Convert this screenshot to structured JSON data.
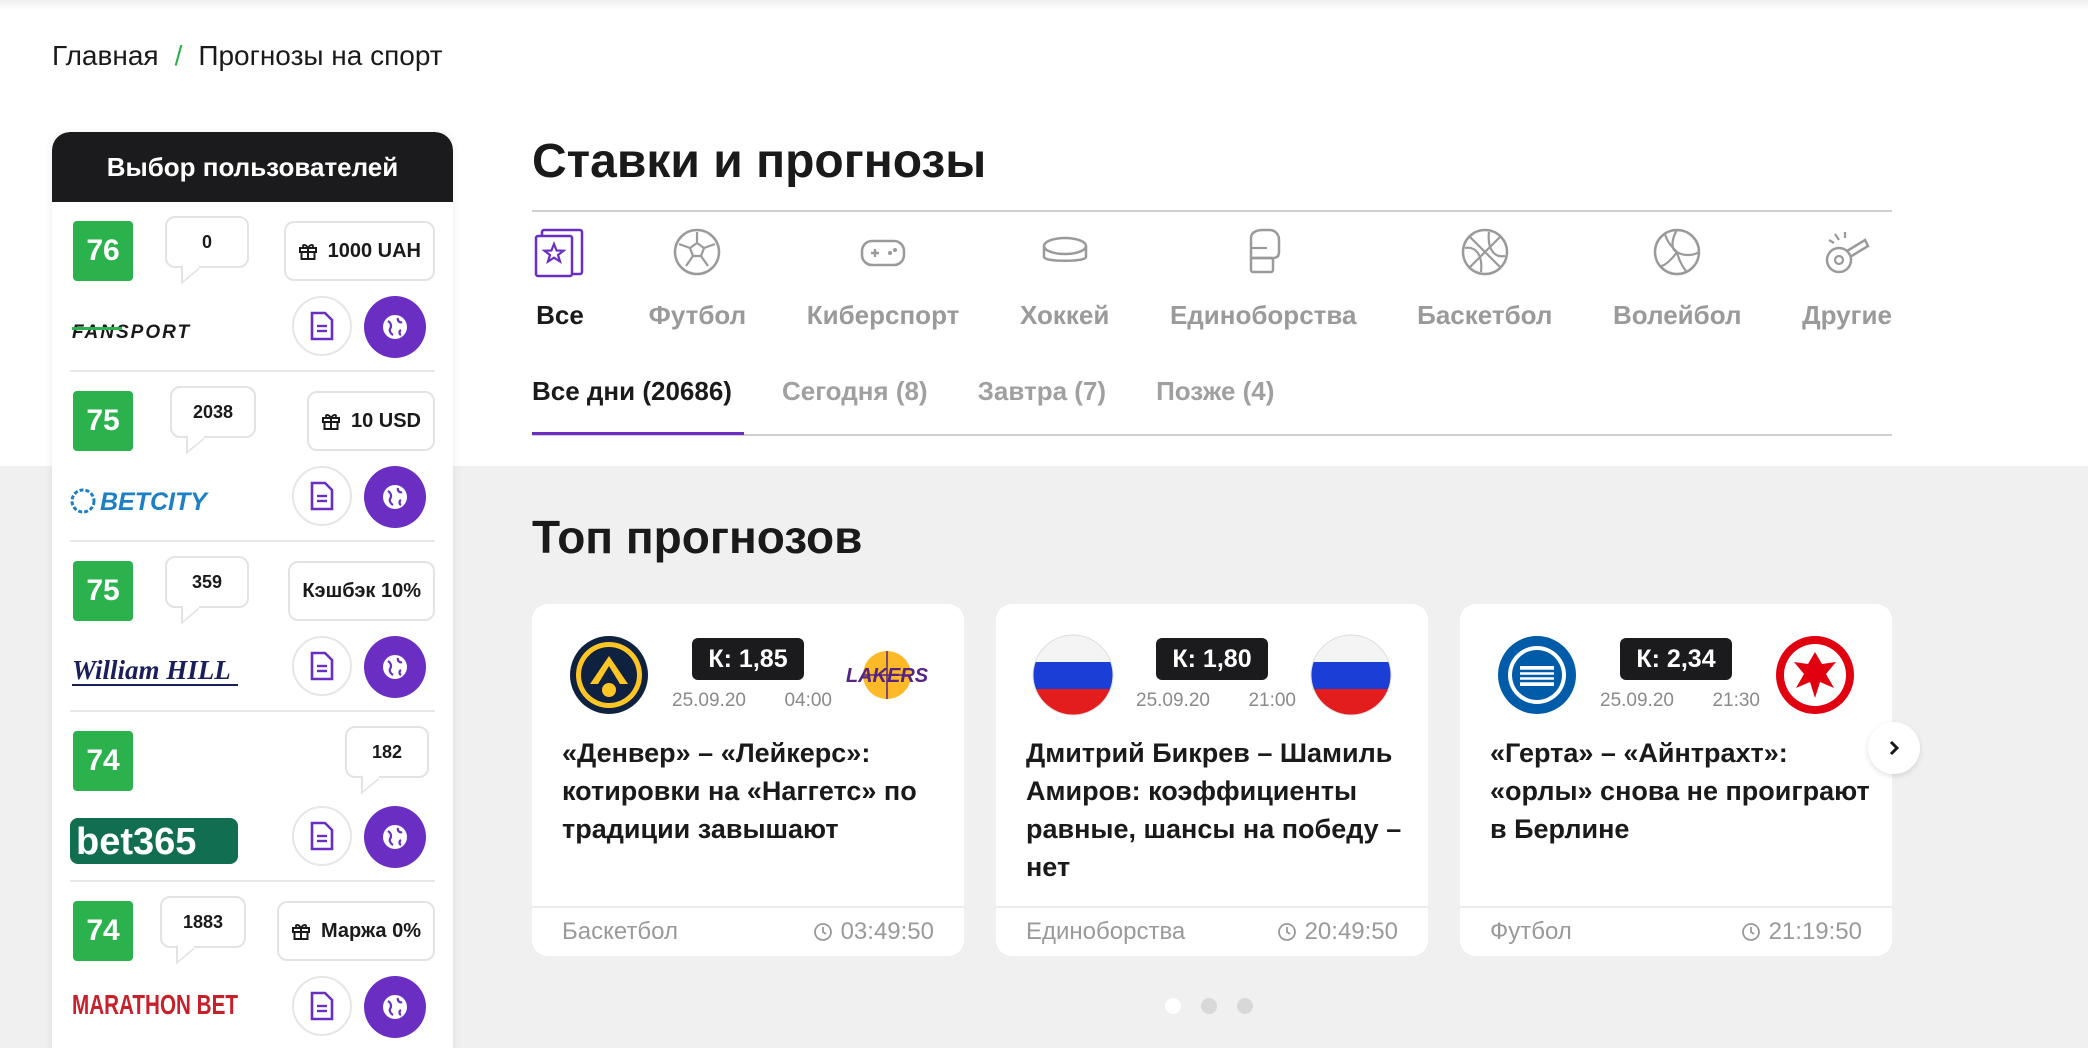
{
  "breadcrumb": {
    "home": "Главная",
    "separator": "/",
    "current": "Прогнозы на спорт"
  },
  "sidebar": {
    "title": "Выбор пользователей",
    "items": [
      {
        "rating": "76",
        "reviews": "0",
        "bonus": "1000 UAH",
        "bonus_icon": "gift-icon",
        "brand": "FANSPORT"
      },
      {
        "rating": "75",
        "reviews": "2038",
        "bonus": "10 USD",
        "bonus_icon": "gift-icon",
        "brand": "BETCITY"
      },
      {
        "rating": "75",
        "reviews": "359",
        "bonus": "Кэшбэк 10%",
        "bonus_icon": "",
        "brand": "William HILL"
      },
      {
        "rating": "74",
        "reviews": "182",
        "bonus": "",
        "bonus_icon": "",
        "brand": "bet365"
      },
      {
        "rating": "74",
        "reviews": "1883",
        "bonus": "Маржа 0%",
        "bonus_icon": "gift-icon",
        "brand": "MARATHON BET"
      }
    ]
  },
  "main": {
    "title": "Ставки и прогнозы",
    "sport_tabs": [
      {
        "label": "Все",
        "icon": "all-sports-icon",
        "active": true
      },
      {
        "label": "Футбол",
        "icon": "football-icon"
      },
      {
        "label": "Киберспорт",
        "icon": "gamepad-icon"
      },
      {
        "label": "Хоккей",
        "icon": "hockey-puck-icon"
      },
      {
        "label": "Единоборства",
        "icon": "boxing-glove-icon"
      },
      {
        "label": "Баскетбол",
        "icon": "basketball-icon"
      },
      {
        "label": "Волейбол",
        "icon": "volleyball-icon"
      },
      {
        "label": "Другие",
        "icon": "whistle-icon"
      }
    ],
    "day_tabs": [
      {
        "label": "Все дни (20686)",
        "active": true
      },
      {
        "label": "Сегодня (8)"
      },
      {
        "label": "Завтра (7)"
      },
      {
        "label": "Позже (4)"
      }
    ],
    "top_title": "Топ прогнозов",
    "cards": [
      {
        "coef": "К: 1,85",
        "date": "25.09.20",
        "time": "04:00",
        "title": "«Денвер» – «Лейкерс»: котировки на «Наггетс» по традиции завышают",
        "sport": "Баскетбол",
        "countdown": "03:49:50",
        "team_left": "denver-nuggets-logo",
        "team_right": "lakers-logo"
      },
      {
        "coef": "К: 1,80",
        "date": "25.09.20",
        "time": "21:00",
        "title": "Дмитрий Бикрев – Шамиль Амиров: коэффициенты равные, шансы на победу – нет",
        "sport": "Единоборства",
        "countdown": "20:49:50",
        "team_left": "russia-flag",
        "team_right": "russia-flag"
      },
      {
        "coef": "К: 2,34",
        "date": "25.09.20",
        "time": "21:30",
        "title": "«Герта» – «Айнтрахт»: «орлы» снова не проиграют в Берлине",
        "sport": "Футбол",
        "countdown": "21:19:50",
        "team_left": "hertha-logo",
        "team_right": "eintracht-logo"
      }
    ],
    "slider_pages": 3,
    "slider_active": 1
  },
  "colors": {
    "accent": "#6a2fc2",
    "rating": "#2bb24c",
    "dark": "#1b1b1d"
  }
}
